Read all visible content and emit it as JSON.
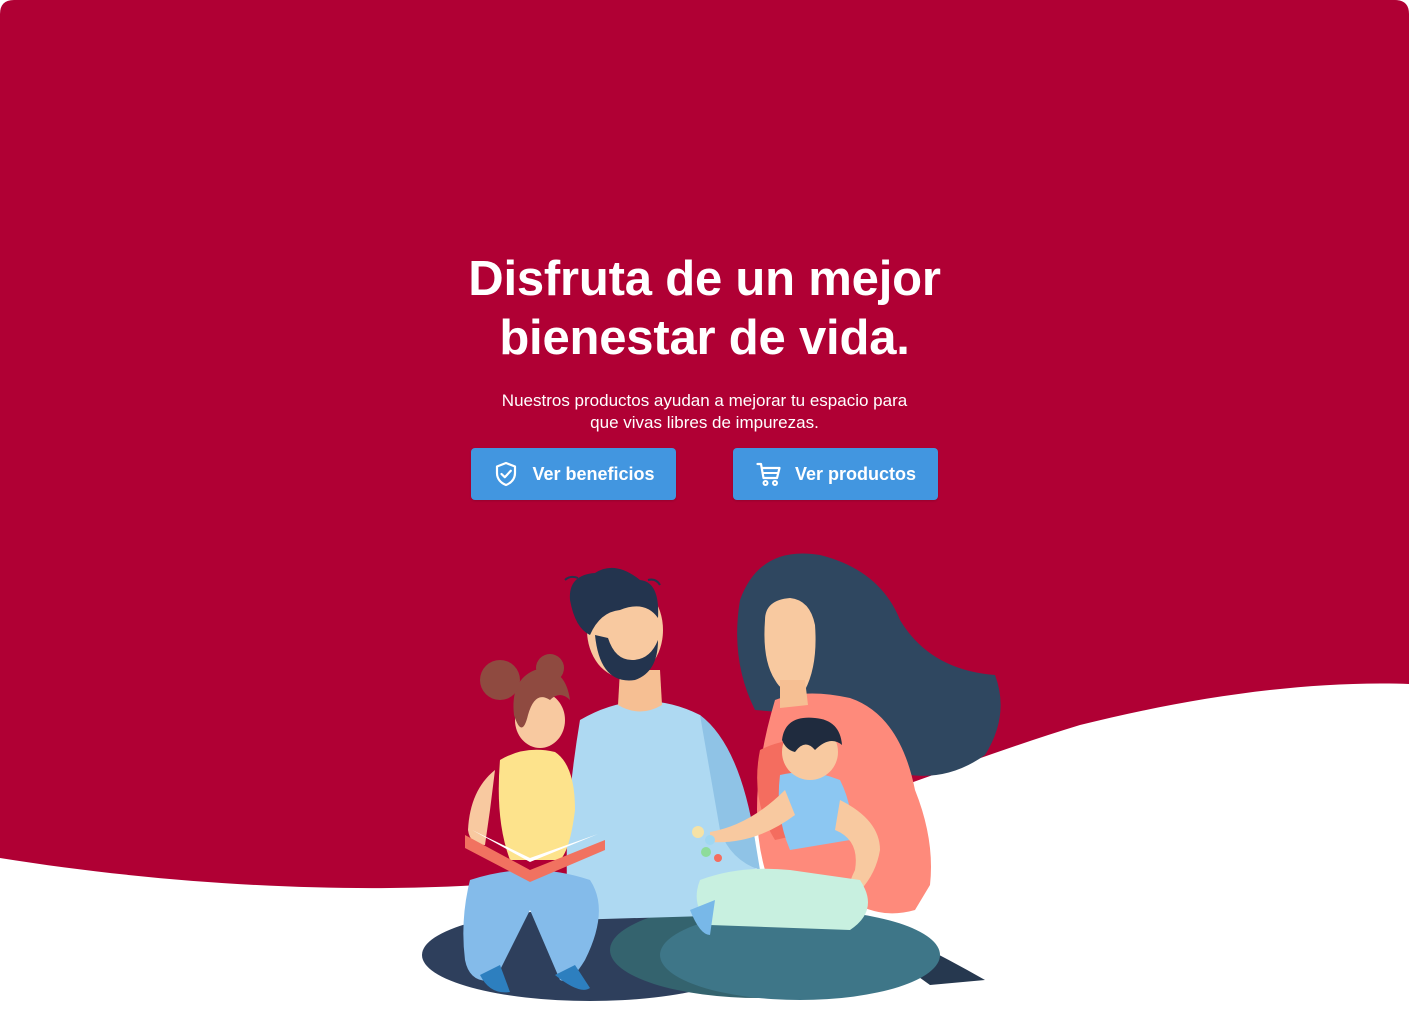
{
  "colors": {
    "brand": "#b00034",
    "button": "#4296e0",
    "background": "#ffffff"
  },
  "hero": {
    "title": "Disfruta de un mejor bienestar de vida.",
    "subtitle": "Nuestros productos ayudan a mejorar tu espacio para que vivas libres de impurezas."
  },
  "buttons": {
    "benefits": {
      "label": "Ver beneficios",
      "icon": "shield-check-icon"
    },
    "products": {
      "label": "Ver productos",
      "icon": "shopping-cart-icon"
    }
  },
  "illustration": {
    "subject": "family-reading-illustration"
  }
}
